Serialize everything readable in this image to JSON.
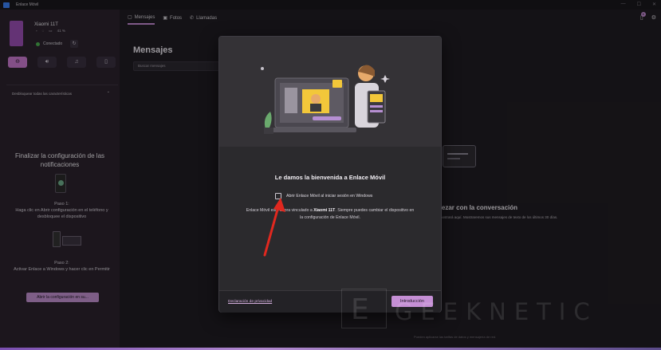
{
  "window": {
    "title": "Enlace Móvil"
  },
  "sidebar": {
    "device_name": "Xiaomi 11T",
    "battery": "41 %",
    "status": "Conectado",
    "expand_label": "Desbloquear todas las características",
    "setup_title": "Finalizar la configuración de las notificaciones",
    "step1_label": "Paso 1:",
    "step1_text": "Haga clic en Abrir configuración en el teléfono y desbloquee el dispositivo",
    "step2_label": "Paso 2:",
    "step2_text": "Activar Enlace a Windows y hacer clic en Permitir",
    "open_config_button": "Abrir la configuración en su..."
  },
  "topnav": {
    "tabs": [
      {
        "label": "Mensajes",
        "icon": "message-icon"
      },
      {
        "label": "Fotos",
        "icon": "photo-icon"
      },
      {
        "label": "Llamadas",
        "icon": "phone-icon"
      }
    ],
    "badge_count": "6"
  },
  "messages": {
    "title": "Mensajes",
    "search_placeholder": "Buscar mensajes",
    "conv_title": "pezar con la conversación",
    "conv_text": "e mostrará aquí. Mostraremos sus mensajes de texto de los últimos 30 días.",
    "footer_note": "Pueden aplicarse las tarifas de datos y mensajería de red."
  },
  "dialog": {
    "title": "Le damos la bienvenida a Enlace Móvil",
    "body_prefix": "Enlace Móvil está ahora vinculado a ",
    "body_device": "Xiaomi 11T",
    "body_suffix": ". Siempre puedes cambiar el dispositivo en la configuración de Enlace Móvil.",
    "checkbox_label": "Abrir Enlace Móvil al iniciar sesión en Windows",
    "checkbox_checked": false,
    "privacy_link": "Declaración de privacidad",
    "intro_button": "Introducción"
  },
  "watermark": {
    "text": "GEEKNETIC",
    "letter": "E"
  },
  "colors": {
    "accent": "#c58fd5",
    "arrow": "#e0281f",
    "connected": "#4caf50"
  }
}
